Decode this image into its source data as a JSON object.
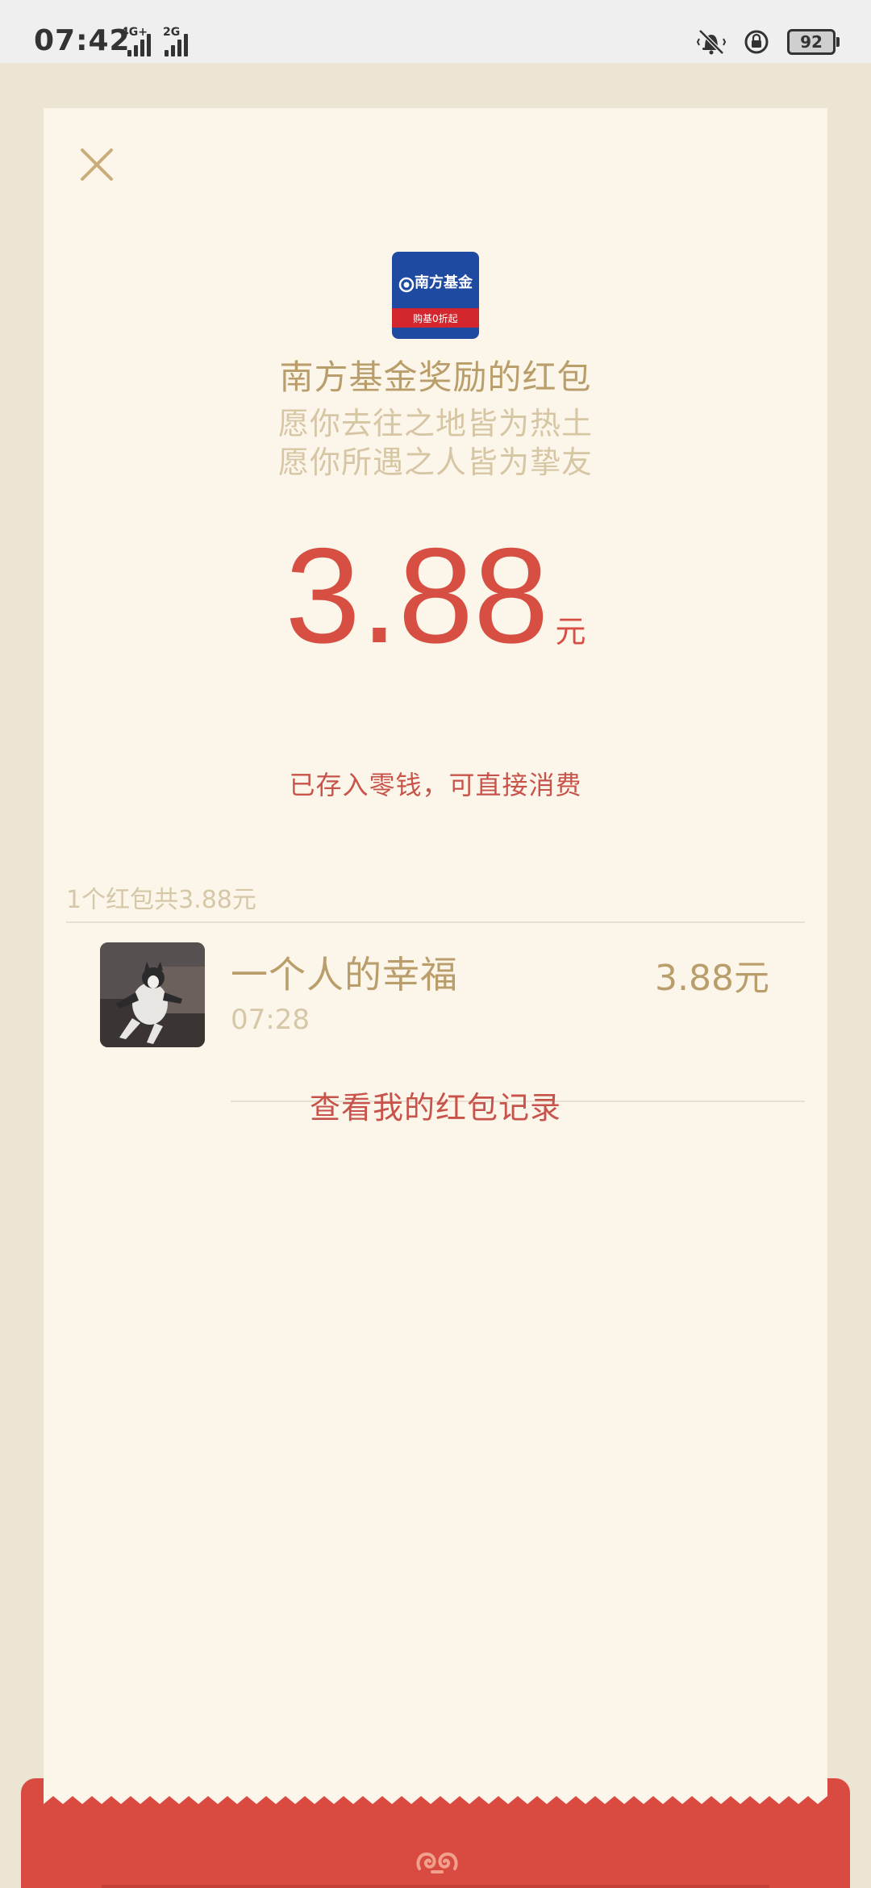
{
  "status_bar": {
    "time": "07:42",
    "network_1": "4G+",
    "network_2": "2G",
    "battery": "92"
  },
  "card": {
    "close_icon": "close-icon",
    "sender": {
      "logo_name": "南方基金",
      "logo_slogan": "购基0折起",
      "title": "南方基金奖励的红包",
      "blessing_1": "愿你去往之地皆为热土",
      "blessing_2": "愿你所遇之人皆为挚友"
    },
    "amount": {
      "value": "3.88",
      "unit": "元",
      "note": "已存入零钱，可直接消费"
    },
    "summary": "1个红包共3.88元",
    "records": [
      {
        "name": "一个人的幸福",
        "time": "07:28",
        "amount": "3.88元"
      }
    ],
    "history_link": "查看我的红包记录"
  },
  "colors": {
    "accent": "#d74e43",
    "gold": "#b99e6c",
    "muted_gold": "#d5c7a7",
    "card_bg": "#fcf6ea",
    "page_bg": "#ede5d4"
  }
}
